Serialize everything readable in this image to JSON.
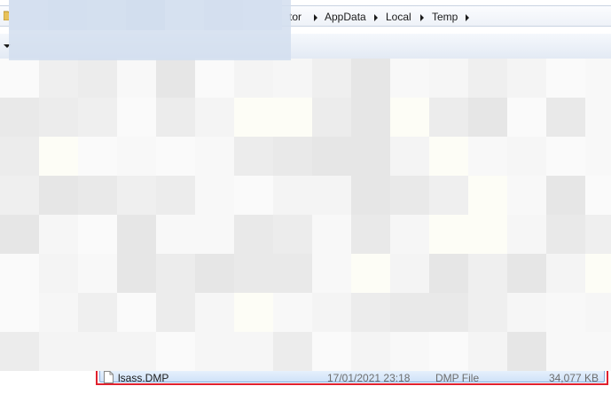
{
  "address_bar": {
    "breadcrumbs": [
      {
        "label": "tor"
      },
      {
        "label": "AppData"
      },
      {
        "label": "Local"
      },
      {
        "label": "Temp"
      }
    ]
  },
  "file_list": {
    "rows": [
      {
        "name": "lsass.DMP",
        "date_modified": "17/01/2021 23:18",
        "type": "DMP File",
        "size": "34,077 KB",
        "icon": "document-icon",
        "highlight_color": "#e0212e"
      }
    ]
  },
  "colors": {
    "selection": "#cfe2f8",
    "highlight_border": "#e0212e"
  }
}
